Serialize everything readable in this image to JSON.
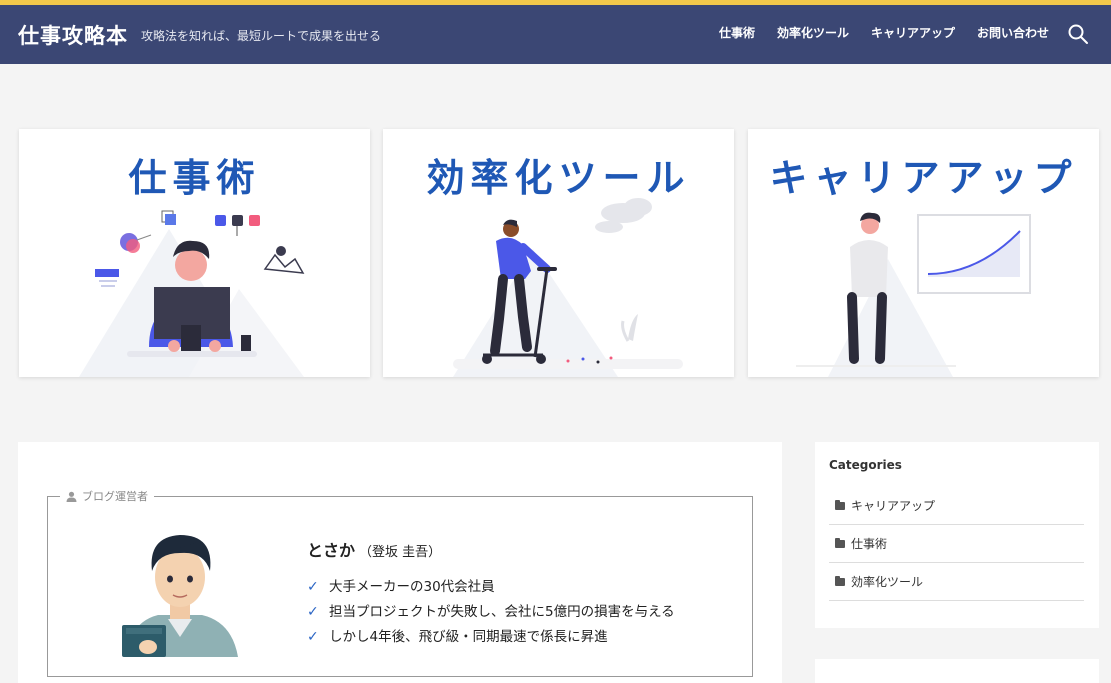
{
  "header": {
    "site_title": "仕事攻略本",
    "tagline": "攻略法を知れば、最短ルートで成果を出せる",
    "nav": [
      "仕事術",
      "効率化ツール",
      "キャリアアップ",
      "お問い合わせ"
    ],
    "search_icon": "search-icon"
  },
  "cards": [
    {
      "title": "仕事術"
    },
    {
      "title": "効率化ツール"
    },
    {
      "title": "キャリアアップ"
    }
  ],
  "profile": {
    "legend": "ブログ運営者",
    "name": "とさか",
    "real_name": "（登坂 圭吾）",
    "facts": [
      "大手メーカーの30代会社員",
      "担当プロジェクトが失敗し、会社に5億円の損害を与える",
      "しかし4年後、飛び級・同期最速で係長に昇進"
    ]
  },
  "sidebar": {
    "title": "Categories",
    "categories": [
      "キャリアアップ",
      "仕事術",
      "効率化ツール"
    ]
  },
  "colors": {
    "header_bg": "#3b4774",
    "accent_line": "#f2c84b",
    "card_title": "#1f58b5",
    "check": "#2a64c4"
  }
}
